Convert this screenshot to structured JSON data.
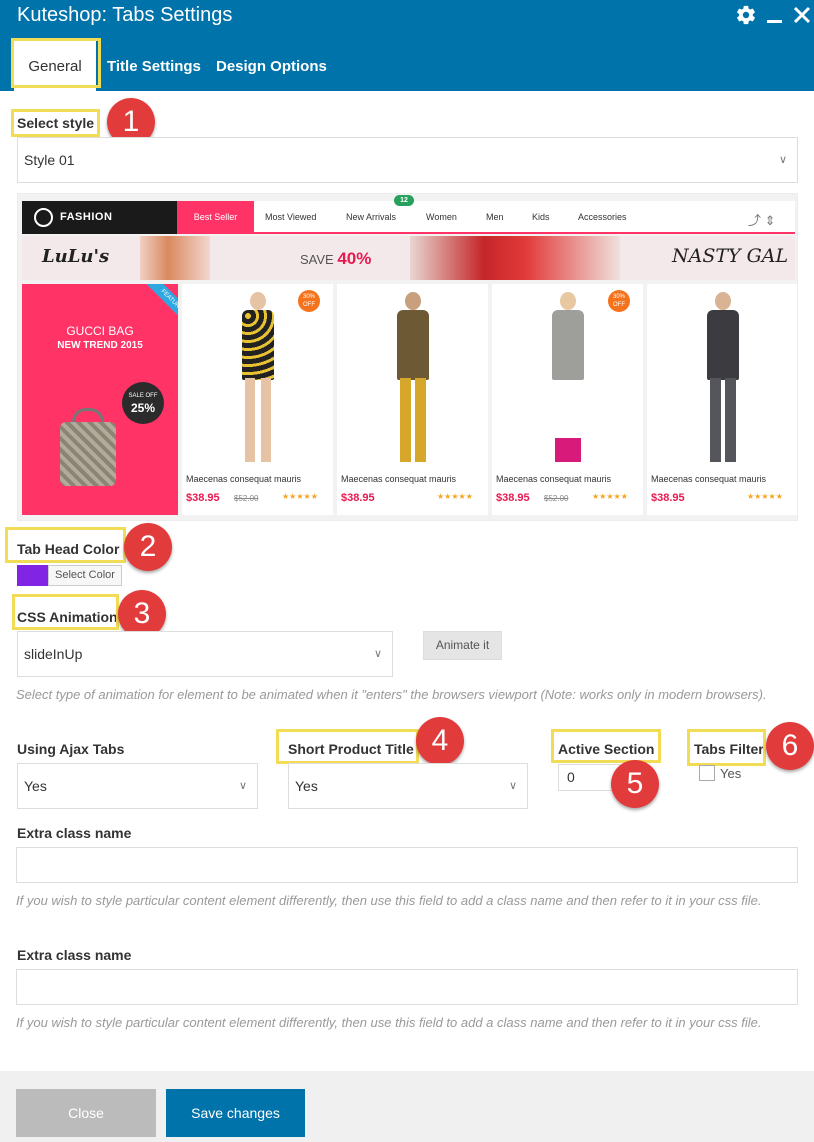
{
  "window": {
    "title": "Kuteshop: Tabs Settings"
  },
  "tabs": [
    "General",
    "Title Settings",
    "Design Options"
  ],
  "colors": {
    "header": "#0073aa",
    "tab_head_color": "#8224e3",
    "highlight": "#f3dc55",
    "badge": "#e23b3b"
  },
  "select_style": {
    "label": "Select style",
    "value": "Style 01"
  },
  "preview": {
    "brand": "FASHION",
    "nav": [
      "Best Seller",
      "Most Viewed",
      "New Arrivals",
      "Women",
      "Men",
      "Kids",
      "Accessories"
    ],
    "new_badge": "12",
    "banner": {
      "left_logo": "LuLu's",
      "save_text": "SAVE",
      "save_value": "40%",
      "right_logo": "NASTY GAL"
    },
    "promo": {
      "title": "GUCCI BAG",
      "subtitle": "NEW TREND 2015",
      "ribbon": "FEATURED",
      "sale_text": "SALE OFF",
      "sale_value": "25%"
    },
    "off_badge": "30%\nOFF",
    "products": [
      {
        "name": "Maecenas consequat mauris",
        "price": "$38.95",
        "old_price": "$52.00",
        "stars": "★★★★★"
      },
      {
        "name": "Maecenas consequat mauris",
        "price": "$38.95",
        "old_price": "",
        "stars": "★★★★★"
      },
      {
        "name": "Maecenas consequat mauris",
        "price": "$38.95",
        "old_price": "$52.00",
        "stars": "★★★★★"
      },
      {
        "name": "Maecenas consequat mauris",
        "price": "$38.95",
        "old_price": "",
        "stars": "★★★★★"
      }
    ]
  },
  "tab_head_color": {
    "label": "Tab Head Color",
    "button": "Select Color"
  },
  "css_animation": {
    "label": "CSS Animation",
    "value": "slideInUp",
    "button": "Animate it",
    "help": "Select type of animation for element to be animated when it \"enters\" the browsers viewport (Note: works only in modern browsers)."
  },
  "ajax_tabs": {
    "label": "Using Ajax Tabs",
    "value": "Yes"
  },
  "short_title": {
    "label": "Short Product Title",
    "value": "Yes"
  },
  "active_section": {
    "label": "Active Section",
    "value": "0"
  },
  "tabs_filter": {
    "label": "Tabs Filter",
    "option": "Yes"
  },
  "extra_class_1": {
    "label": "Extra class name",
    "value": "",
    "help": "If you wish to style particular content element differently, then use this field to add a class name and then refer to it in your css file."
  },
  "extra_class_2": {
    "label": "Extra class name",
    "value": "",
    "help": "If you wish to style particular content element differently, then use this field to add a class name and then refer to it in your css file."
  },
  "badges": [
    "1",
    "2",
    "3",
    "4",
    "5",
    "6"
  ],
  "footer": {
    "close": "Close",
    "save": "Save changes"
  }
}
